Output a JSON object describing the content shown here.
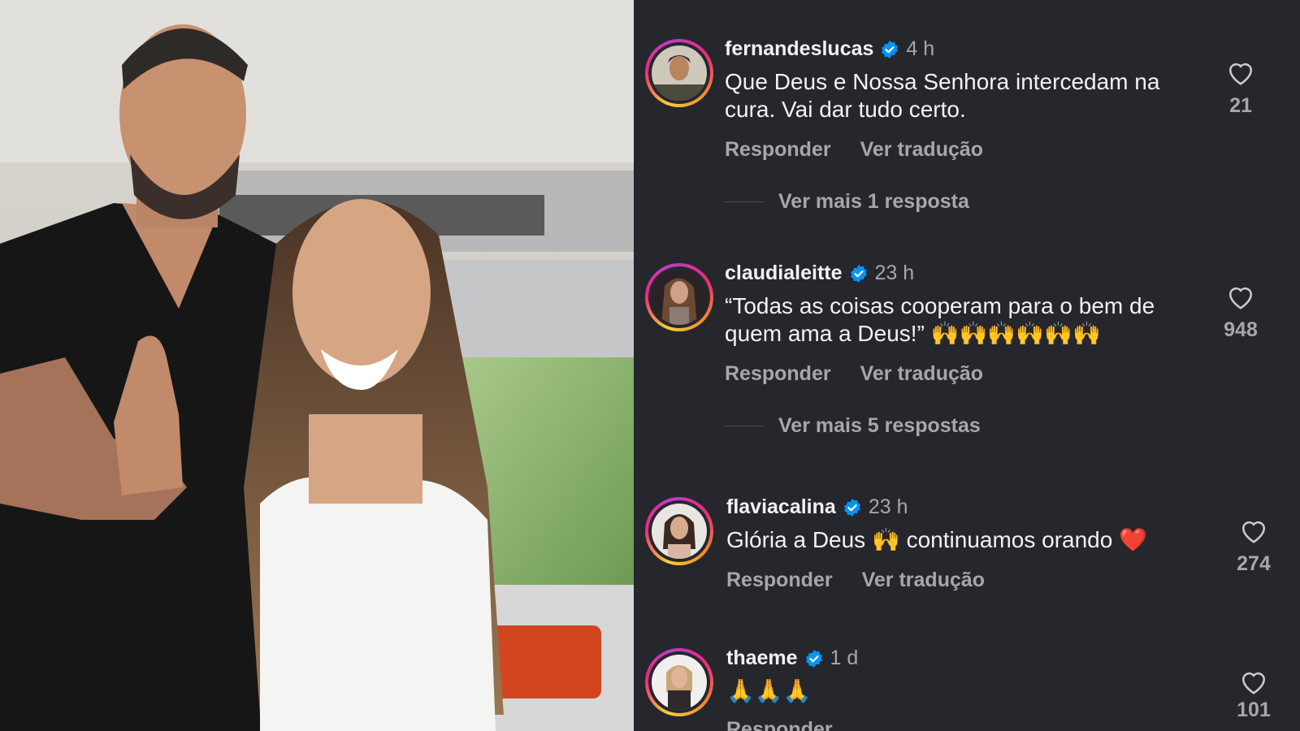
{
  "comments": [
    {
      "username": "fernandeslucas",
      "time": "4 h",
      "text": "Que Deus e Nossa Senhora intercedam na cura. Vai dar tudo certo.",
      "reply_label": "Responder",
      "translate_label": "Ver tradução",
      "more_replies": "Ver mais 1 resposta",
      "likes": "21"
    },
    {
      "username": "claudialeitte",
      "time": "23 h",
      "text": "“Todas as coisas cooperam para o bem de quem ama a Deus!” 🙌🙌🙌🙌🙌🙌",
      "reply_label": "Responder",
      "translate_label": "Ver tradução",
      "more_replies": "Ver mais 5 respostas",
      "likes": "948"
    },
    {
      "username": "flaviacalina",
      "time": "23 h",
      "text": "Glória a Deus 🙌 continuamos orando ❤️",
      "reply_label": "Responder",
      "translate_label": "Ver tradução",
      "likes": "274"
    },
    {
      "username": "thaeme",
      "time": "1 d",
      "text": "🙏🙏🙏",
      "reply_label": "Responder",
      "likes": "101"
    }
  ],
  "icons": {
    "like": "heart-outline-icon",
    "verified": "verified-badge-icon"
  },
  "colors": {
    "background": "#25272d",
    "verified": "#0095f6",
    "primary_text": "#f2f2f2",
    "secondary_text": "#a5a7ad"
  }
}
